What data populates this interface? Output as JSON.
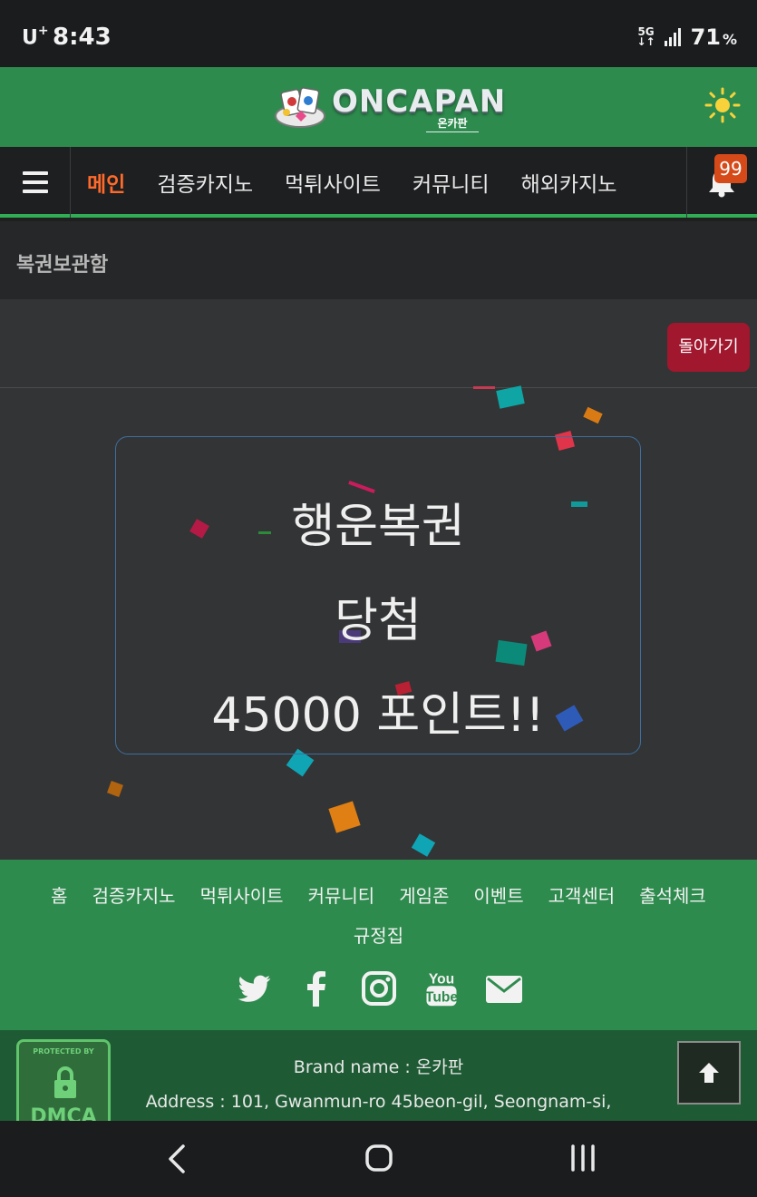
{
  "status_bar": {
    "carrier": "U",
    "carrier_sup": "+",
    "time": "8:43",
    "network": "5G",
    "battery": "71",
    "battery_unit": "%"
  },
  "header": {
    "logo_text": "ONCAPAN",
    "logo_sub": "온카판",
    "theme_icon": "sun-icon"
  },
  "nav": {
    "items": [
      "메인",
      "검증카지노",
      "먹튀사이트",
      "커뮤니티",
      "해외카지노"
    ],
    "active_index": 0,
    "notification_count": "99",
    "colors": {
      "active": "#ff6a2b",
      "accent_bar": "#2fae55"
    }
  },
  "page": {
    "title": "복권보관함",
    "back_button": "돌아가기"
  },
  "prize": {
    "line1": "행운복권",
    "line2": "당첨",
    "line3": "45000 포인트!!"
  },
  "footer": {
    "links": [
      "홈",
      "검증카지노",
      "먹튀사이트",
      "커뮤니티",
      "게임존",
      "이벤트",
      "고객센터",
      "출석체크",
      "규정집"
    ],
    "socials": [
      "twitter-icon",
      "facebook-icon",
      "instagram-icon",
      "youtube-icon",
      "email-icon"
    ],
    "youtube_label_top": "You",
    "youtube_label_bottom": "Tube",
    "dmca_top": "PROTECTED BY",
    "dmca_text": "DMCA",
    "brand_line": "Brand name : 온카판",
    "address_line": "Address : 101, Gwanmun-ro 45beon-gil, Seongnam-si,",
    "colors": {
      "green": "#2e8b4e",
      "dark_green": "#1e5b34"
    }
  }
}
